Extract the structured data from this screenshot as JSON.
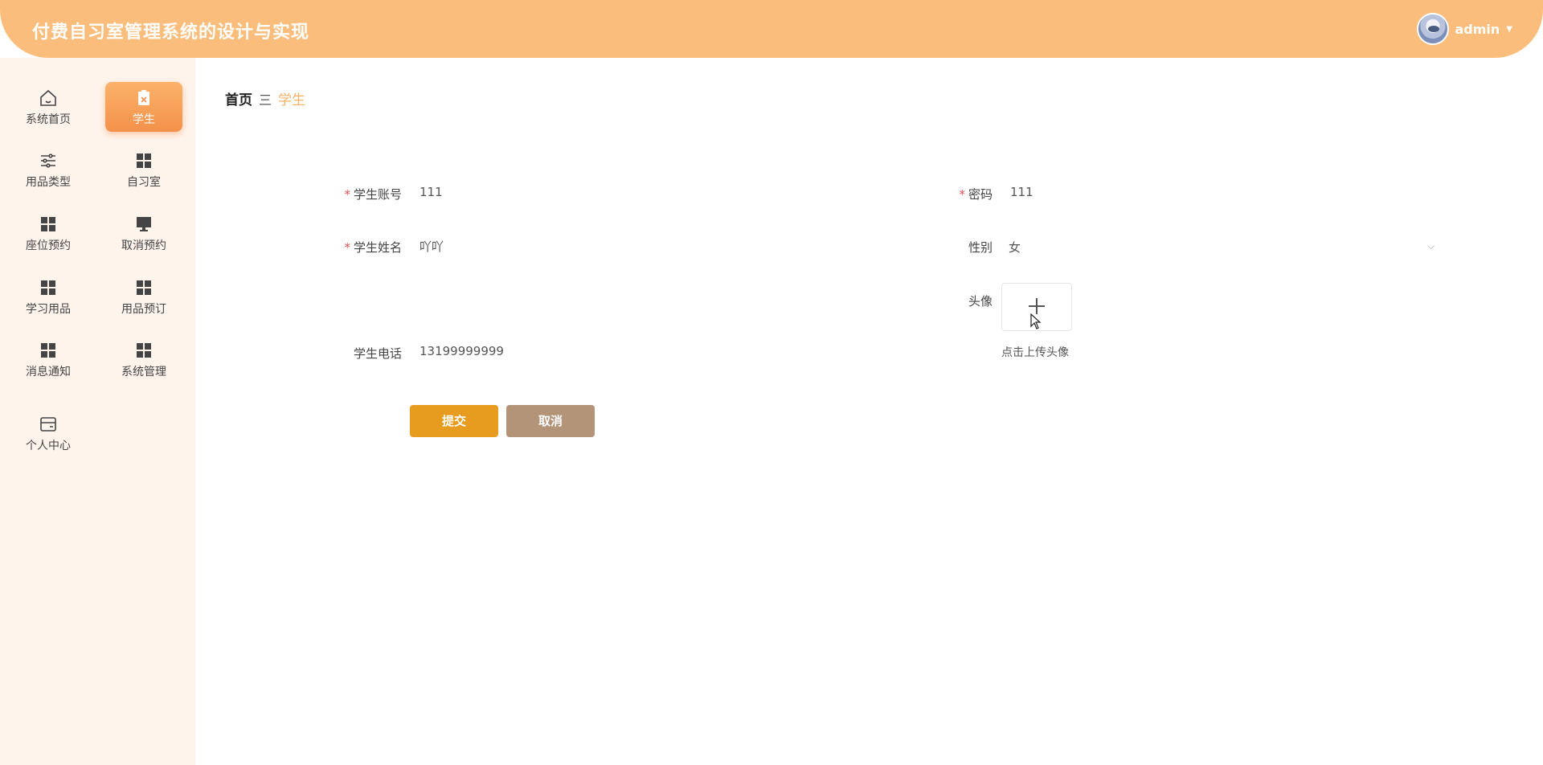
{
  "header": {
    "title": "付费自习室管理系统的设计与实现",
    "username": "admin"
  },
  "sidebar": {
    "items": [
      {
        "label": "系统首页",
        "icon": "home-icon"
      },
      {
        "label": "学生",
        "icon": "clipboard-icon",
        "active": true
      },
      {
        "label": "用品类型",
        "icon": "sliders-icon"
      },
      {
        "label": "自习室",
        "icon": "grid-icon"
      },
      {
        "label": "座位预约",
        "icon": "grid-icon"
      },
      {
        "label": "取消预约",
        "icon": "monitor-icon"
      },
      {
        "label": "学习用品",
        "icon": "grid-icon"
      },
      {
        "label": "用品预订",
        "icon": "grid-icon"
      },
      {
        "label": "消息通知",
        "icon": "grid-icon"
      },
      {
        "label": "系统管理",
        "icon": "grid-icon"
      },
      {
        "label": "个人中心",
        "icon": "card-icon"
      }
    ]
  },
  "breadcrumb": {
    "home": "首页",
    "separator": "三",
    "current": "学生"
  },
  "form": {
    "account_label": "学生账号",
    "account_value": "111",
    "password_label": "密码",
    "password_value": "111",
    "name_label": "学生姓名",
    "name_value": "吖吖",
    "gender_label": "性别",
    "gender_value": "女",
    "avatar_label": "头像",
    "upload_hint": "点击上传头像",
    "phone_label": "学生电话",
    "phone_value": "13199999999",
    "required_mark": "*"
  },
  "buttons": {
    "submit": "提交",
    "cancel": "取消"
  },
  "colors": {
    "header_bg": "#fbbd7b",
    "sidebar_bg": "#fff4ec",
    "accent": "#f4914a",
    "submit": "#e89c1f",
    "cancel": "#b39479"
  }
}
